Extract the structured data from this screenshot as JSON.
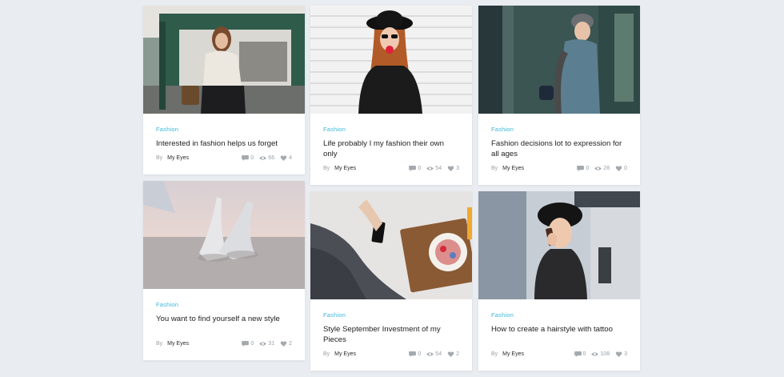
{
  "posts": [
    {
      "category": "Fashion",
      "title": "Interested in fashion helps us forget",
      "by": "By",
      "author": "My Eyes",
      "comments": "0",
      "views": "66",
      "likes": "4"
    },
    {
      "category": "Fashion",
      "title": "Life probably I my fashion their own only",
      "by": "By",
      "author": "My Eyes",
      "comments": "0",
      "views": "54",
      "likes": "3"
    },
    {
      "category": "Fashion",
      "title": "Fashion decisions lot to expression for all ages",
      "by": "By",
      "author": "My Eyes",
      "comments": "0",
      "views": "28",
      "likes": "0"
    },
    {
      "category": "Fashion",
      "title": "You want to find yourself a new style",
      "by": "By",
      "author": "My Eyes",
      "comments": "0",
      "views": "31",
      "likes": "2"
    },
    {
      "category": "Fashion",
      "title": "Style September Investment of my Pieces",
      "by": "By",
      "author": "My Eyes",
      "comments": "0",
      "views": "54",
      "likes": "2"
    },
    {
      "category": "Fashion",
      "title": "How to create a hairstyle with tattoo",
      "by": "By",
      "author": "My Eyes",
      "comments": "0",
      "views": "108",
      "likes": "3"
    }
  ],
  "icons": {
    "comments": "comment-icon",
    "views": "eye-icon",
    "likes": "heart-icon"
  },
  "colors": {
    "background": "#e9edf1",
    "category": "#3cb7d6",
    "card": "#ffffff"
  }
}
